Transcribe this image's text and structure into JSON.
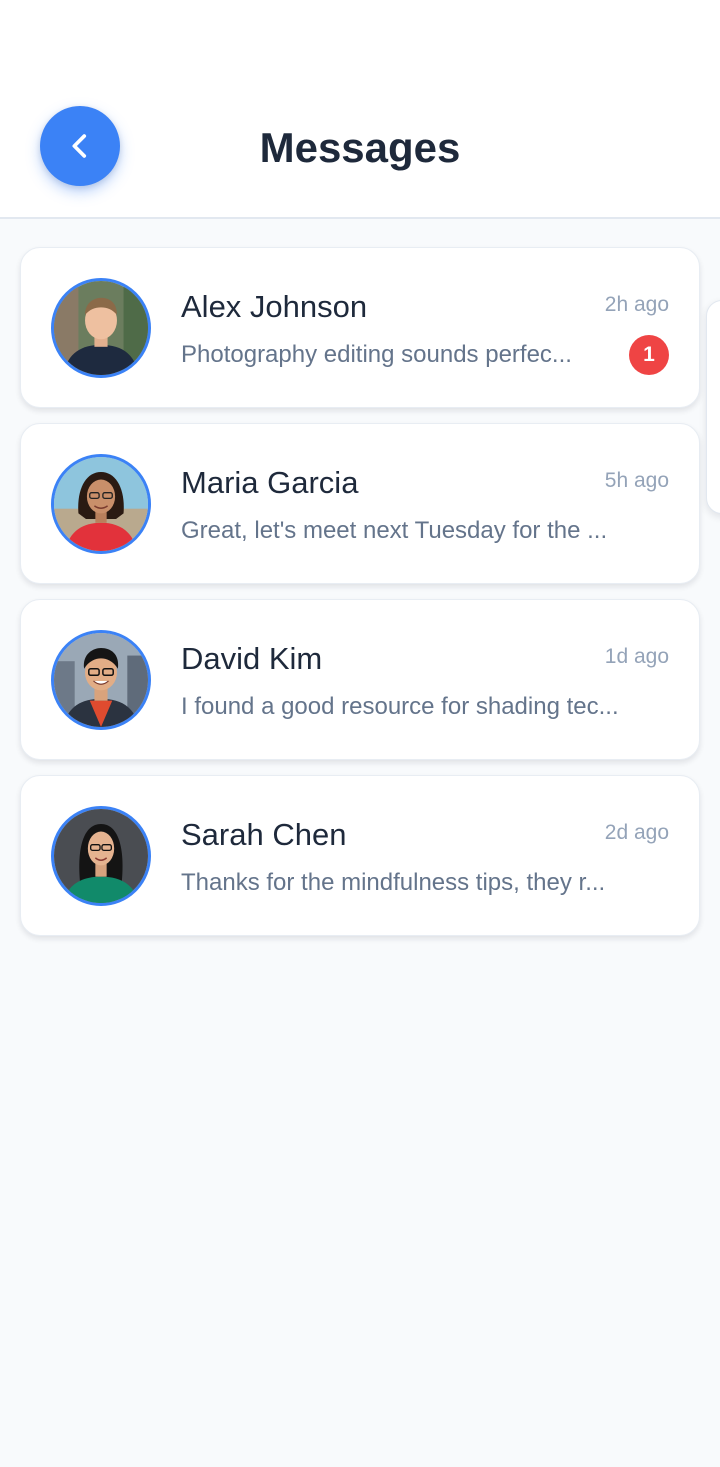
{
  "header": {
    "title": "Messages",
    "back_icon": "chevron-left-icon"
  },
  "colors": {
    "accent": "#3b82f6",
    "badge": "#ef4444",
    "title_text": "#1e293b",
    "muted_text": "#64748b",
    "time_text": "#94a3b8",
    "background": "#f8fafc"
  },
  "conversations": [
    {
      "name": "Alex Johnson",
      "time": "2h ago",
      "preview": "Photography editing sounds perfec...",
      "unread": "1"
    },
    {
      "name": "Maria Garcia",
      "time": "5h ago",
      "preview": "Great, let's meet next Tuesday for the ..."
    },
    {
      "name": "David Kim",
      "time": "1d ago",
      "preview": "I found a good resource for shading tec..."
    },
    {
      "name": "Sarah Chen",
      "time": "2d ago",
      "preview": "Thanks for the mindfulness tips, they r..."
    }
  ]
}
